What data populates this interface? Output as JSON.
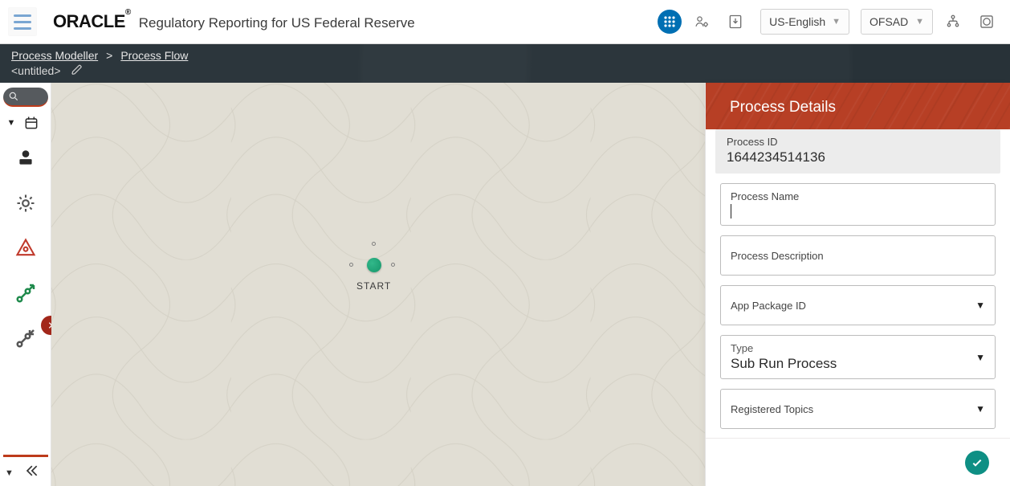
{
  "header": {
    "brand": "ORACLE",
    "brand_sup": "®",
    "app_title": "Regulatory Reporting for US Federal Reserve",
    "language": "US-English",
    "profile": "OFSAD"
  },
  "breadcrumb": {
    "items": [
      "Process Modeller",
      "Process Flow"
    ],
    "separator": ">",
    "current_title": "<untitled>"
  },
  "canvas": {
    "start_label": "START"
  },
  "details": {
    "title": "Process Details",
    "process_id_label": "Process ID",
    "process_id_value": "1644234514136",
    "process_name_label": "Process Name",
    "process_name_value": "",
    "process_desc_label": "Process Description",
    "process_desc_value": "",
    "app_package_label": "App Package ID",
    "app_package_value": "",
    "type_label": "Type",
    "type_value": "Sub Run Process",
    "topics_label": "Registered Topics",
    "topics_value": ""
  }
}
